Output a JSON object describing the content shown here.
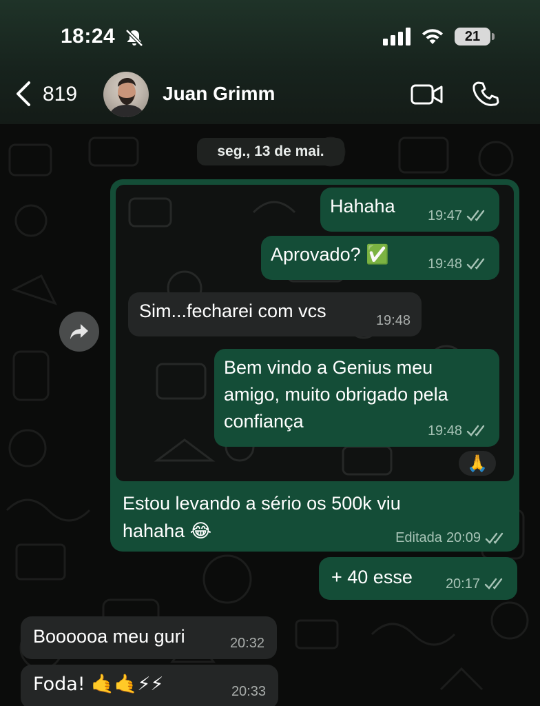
{
  "status_bar": {
    "time": "18:24",
    "battery": "21"
  },
  "header": {
    "back_count": "819",
    "contact_name": "Juan Grimm"
  },
  "chat": {
    "date": "seg., 13 de mai.",
    "quoted": [
      {
        "text": "Hahaha",
        "time": "19:47",
        "dir": "out"
      },
      {
        "text": "Aprovado? ✅",
        "time": "19:48",
        "dir": "out"
      },
      {
        "text": "Sim...fecharei com vcs",
        "time": "19:48",
        "dir": "in"
      },
      {
        "text": "Bem vindo a Genius meu amigo, muito obrigado pela confiança",
        "time": "19:48",
        "dir": "out",
        "reaction": "🙏"
      }
    ],
    "messages": [
      {
        "text": "Estou levando a sério os 500k viu hahaha 😂",
        "time": "20:09",
        "edited_label": "Editada",
        "dir": "out"
      },
      {
        "text": "+ 40 esse",
        "time": "20:17",
        "dir": "out"
      },
      {
        "text": "Boooooa meu guri",
        "time": "20:32",
        "dir": "in"
      },
      {
        "text": "Foda! 🤙🤙⚡⚡",
        "time": "20:33",
        "dir": "in"
      }
    ]
  },
  "colors": {
    "outgoing": "#144d37",
    "incoming": "#242626",
    "tick": "#a7c3b6"
  }
}
